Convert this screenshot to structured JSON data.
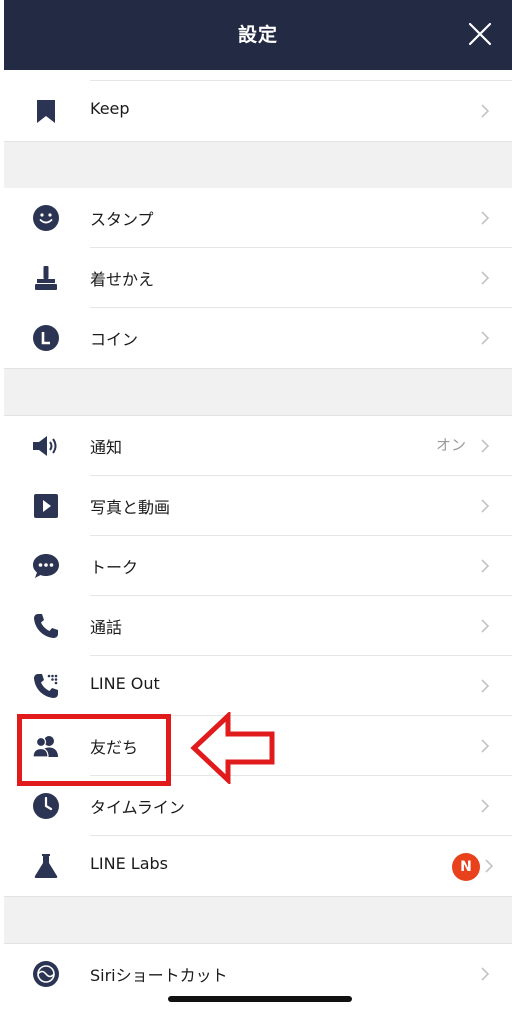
{
  "header": {
    "title": "設定",
    "close_icon": "close-icon"
  },
  "sections": {
    "keep": {
      "label": "Keep",
      "icon": "bookmark-icon"
    },
    "stamp": {
      "label": "スタンプ",
      "icon": "smiley-icon"
    },
    "theme": {
      "label": "着せかえ",
      "icon": "brush-icon"
    },
    "coin": {
      "label": "コイン",
      "icon": "coin-icon"
    },
    "notification": {
      "label": "通知",
      "value": "オン",
      "icon": "speaker-icon"
    },
    "photo_video": {
      "label": "写真と動画",
      "icon": "play-icon"
    },
    "talk": {
      "label": "トーク",
      "icon": "chat-bubble-icon"
    },
    "call": {
      "label": "通話",
      "icon": "phone-icon"
    },
    "line_out": {
      "label": "LINE Out",
      "icon": "phone-dialpad-icon"
    },
    "friends": {
      "label": "友だち",
      "icon": "friends-icon"
    },
    "timeline": {
      "label": "タイムライン",
      "icon": "clock-icon"
    },
    "labs": {
      "label": "LINE Labs",
      "badge": "N",
      "icon": "flask-icon"
    },
    "siri": {
      "label": "Siriショートカット",
      "icon": "siri-icon"
    }
  },
  "annotation": {
    "color": "#e11b1b",
    "target": "friends"
  },
  "colors": {
    "header_bg": "#232a44",
    "icon": "#2b3452",
    "badge": "#e8411b"
  }
}
